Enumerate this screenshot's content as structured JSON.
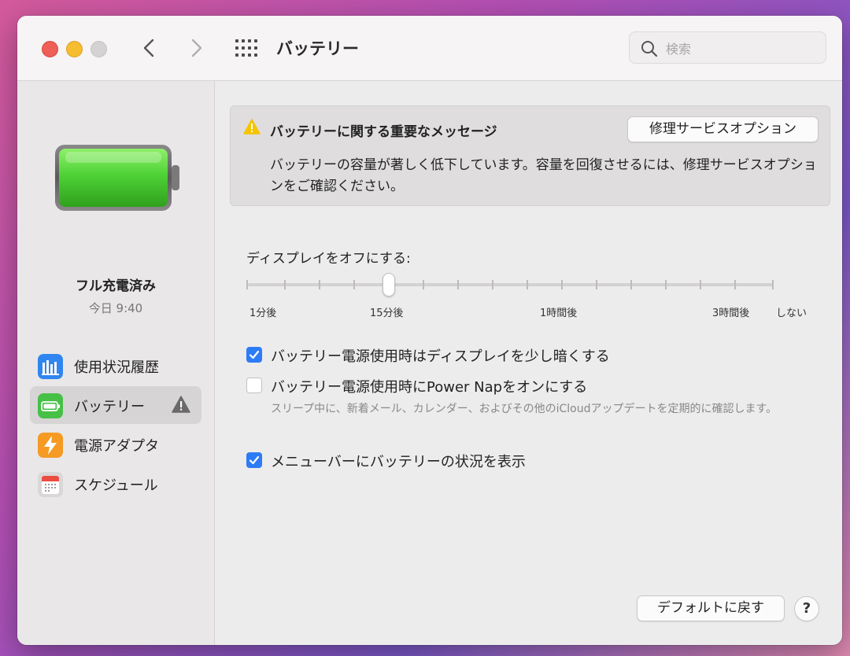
{
  "window": {
    "title": "バッテリー",
    "search_placeholder": "検索"
  },
  "sidebar": {
    "battery_status": "フル充電済み",
    "battery_time": "今日 9:40",
    "items": [
      {
        "label": "使用状況履歴",
        "icon": "bar-chart-icon"
      },
      {
        "label": "バッテリー",
        "icon": "battery-icon",
        "selected": true,
        "warning": true
      },
      {
        "label": "電源アダプタ",
        "icon": "lightning-icon"
      },
      {
        "label": "スケジュール",
        "icon": "calendar-icon"
      }
    ]
  },
  "alert": {
    "title": "バッテリーに関する重要なメッセージ",
    "body": "バッテリーの容量が著しく低下しています。容量を回復させるには、修理サービスオプションをご確認ください。",
    "button_label": "修理サービスオプション"
  },
  "display_off": {
    "label": "ディスプレイをオフにする:",
    "tick_labels": [
      "1分後",
      "15分後",
      "1時間後",
      "3時間後",
      "しない"
    ],
    "selected": "15分後"
  },
  "options": [
    {
      "label": "バッテリー電源使用時はディスプレイを少し暗くする",
      "checked": true
    },
    {
      "label": "バッテリー電源使用時にPower Napをオンにする",
      "checked": false,
      "description": "スリープ中に、新着メール、カレンダー、およびその他のiCloudアップデートを定期的に確認します。"
    },
    {
      "label": "メニューバーにバッテリーの状況を表示",
      "checked": true
    }
  ],
  "footer": {
    "default_button": "デフォルトに戻す",
    "help_label": "?"
  },
  "colors": {
    "accent": "#2d7cf6",
    "battery_green": "#4fd236",
    "warning_yellow": "#f5c400"
  }
}
